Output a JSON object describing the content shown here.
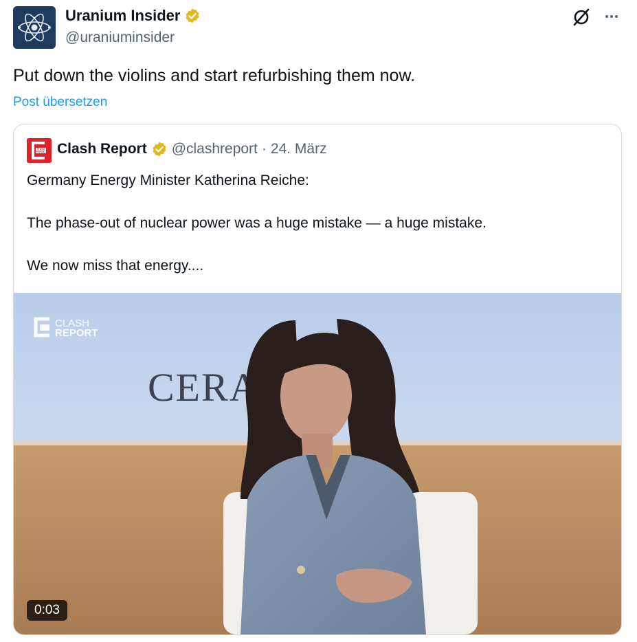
{
  "author": {
    "name": "Uranium Insider",
    "handle": "@uraniuminsider",
    "avatar_icon": "atom-icon",
    "verified_color": "#e2b719"
  },
  "post": {
    "text": "Put down the violins and start refurbishing them now.",
    "translate_label": "Post übersetzen"
  },
  "actions": {
    "grok_icon": "grok-icon",
    "more_icon": "more-dots-icon"
  },
  "quote": {
    "author_name": "Clash Report",
    "handle": "@clashreport",
    "separator": "·",
    "date": "24. März",
    "lines": [
      "Germany Energy Minister Katherina Reiche:",
      "The phase-out of nuclear power was a huge mistake — a huge mistake.",
      "We now miss that energy...."
    ],
    "avatar_text": "CLASH REPORT",
    "media": {
      "watermark_top": "CLASH",
      "watermark_bottom": "REPORT",
      "backdrop_text": "CERAV",
      "duration": "0:03"
    }
  },
  "colors": {
    "link": "#1d9bf0",
    "muted": "#536471",
    "text": "#0f1419",
    "border": "#cfd9de",
    "clash_red": "#e0212a"
  }
}
